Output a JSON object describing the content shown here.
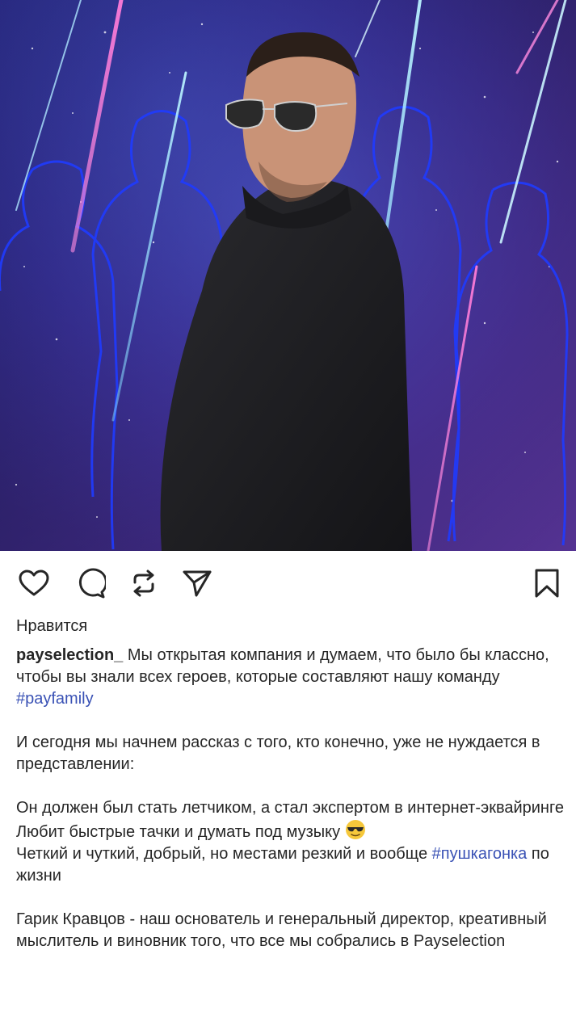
{
  "post": {
    "image_alt": "Promotional post photo",
    "actions": {
      "like_icon": "heart-icon",
      "comment_icon": "comment-icon",
      "repost_icon": "repost-icon",
      "share_icon": "send-icon",
      "save_icon": "bookmark-icon"
    },
    "likes_label": "Нравится",
    "caption": {
      "username": "payselection_",
      "p1_text": " Мы открытая компания и думаем, что было бы классно, чтобы вы знали всех героев, которые составляют нашу команду ",
      "p1_hashtag": "#payfamily",
      "p2": "И сегодня мы начнем рассказ с того, кто конечно, уже не нуждается в представлении:",
      "p3_line1": "Он должен был стать летчиком, а стал экспертом в интернет-эквайринге",
      "p3_line2": "Любит быстрые тачки и думать под музыку ",
      "p3_line2_emoji": "sunglasses-emoji",
      "p3_line3": "Четкий и чуткий, добрый, но местами резкий и вообще ",
      "p3_hashtag": "#пушкагонка",
      "p3_line3_end": " по жизни",
      "p4": "Гарик Кравцов - наш основатель и генеральный директор, креативный мыслитель и виновник того, что все мы собрались в Payselection"
    },
    "colors": {
      "text": "#262626",
      "hashtag": "#3a52b5",
      "background": "#ffffff"
    }
  }
}
